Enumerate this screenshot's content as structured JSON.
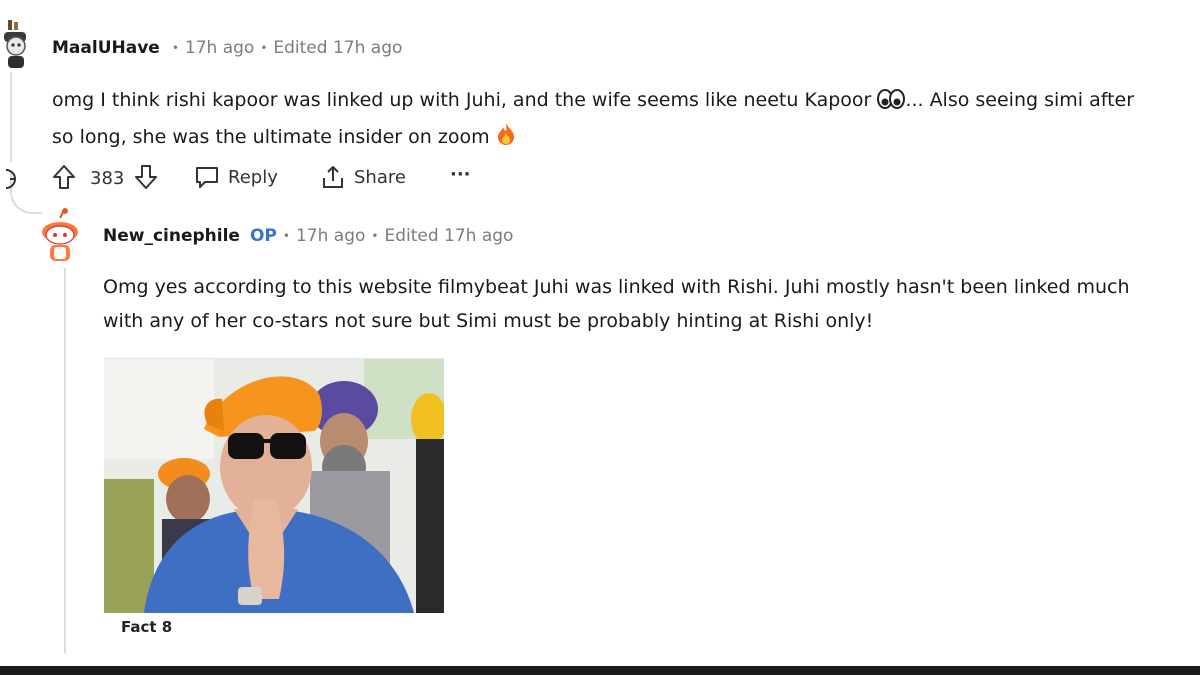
{
  "comment1": {
    "username": "MaalUHave",
    "time": "17h ago",
    "edited": "Edited 17h ago",
    "text_line1": "omg I think rishi kapoor was linked up with Juhi, and the wife seems like neetu Kapoor",
    "text_line1_after": "... Also seeing simi after",
    "text_line2": "so long, she was the ultimate insider on zoom",
    "emoji1": "eyes-emoji",
    "emoji2": "fire-emoji",
    "votes": "383",
    "reply_label": "Reply",
    "share_label": "Share",
    "more_label": "···"
  },
  "comment2": {
    "username": "New_cinephile",
    "op_badge": "OP",
    "time": "17h ago",
    "edited": "Edited 17h ago",
    "text_line1": "Omg yes according to this website filmybeat Juhi was linked with Rishi. Juhi mostly hasn't been linked much",
    "text_line2": "with any of her co-stars not sure but Simi must be probably hinting at Rishi only!",
    "image_caption": "Fact 8"
  },
  "colors": {
    "accent_op": "#3b74c6",
    "meta_gray": "#7c7c7c",
    "thread_line": "#dcdcdc"
  }
}
